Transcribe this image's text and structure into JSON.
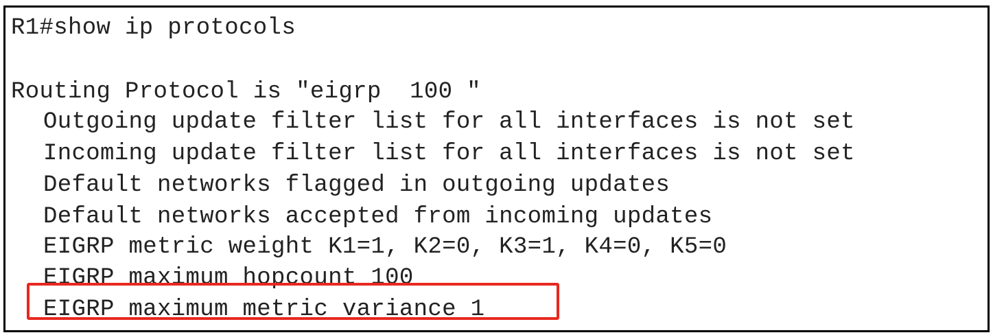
{
  "terminal": {
    "lines": {
      "command": "R1#show ip protocols",
      "protocol": "Routing Protocol is \"eigrp  100 \"",
      "outgoing_filter": "Outgoing update filter list for all interfaces is not set",
      "incoming_filter": "Incoming update filter list for all interfaces is not set",
      "default_flagged": "Default networks flagged in outgoing updates",
      "default_accepted": "Default networks accepted from incoming updates",
      "metric_weight": "EIGRP metric weight K1=1, K2=0, K3=1, K4=0, K5=0",
      "max_hopcount": "EIGRP maximum hopcount 100",
      "max_variance": "EIGRP maximum metric variance 1"
    }
  },
  "colors": {
    "text": "#222222",
    "border": "#000000",
    "highlight": "#e8281e",
    "background": "#ffffff"
  }
}
